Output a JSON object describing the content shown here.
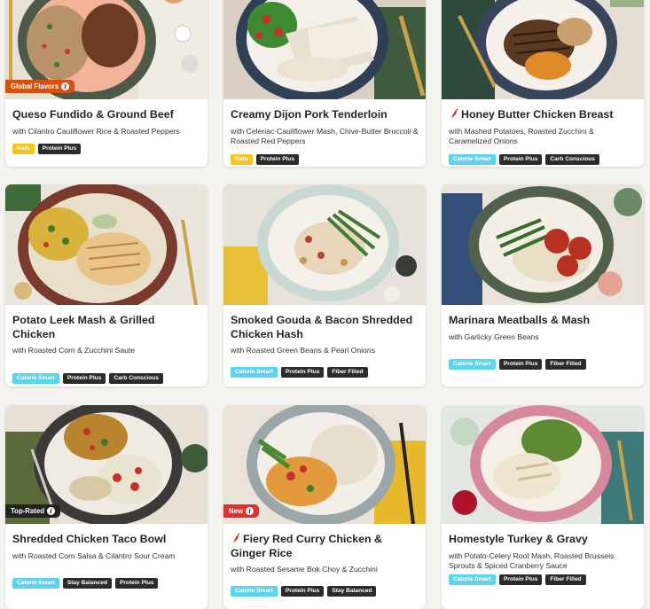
{
  "meals": [
    {
      "title": "Queso Fundido & Ground Beef",
      "subtitle": "with Cilantro Cauliflower Rice & Roasted Peppers",
      "badge": "Global Flavors",
      "spicy": false,
      "tags": [
        "Keto",
        "Protein Plus"
      ],
      "photo": "beef-rice-bowl"
    },
    {
      "title": "Creamy Dijon Pork Tenderloin",
      "subtitle": "with Celeriac-Cauliflower Mash, Chive-Butter Broccoli & Roasted Red Peppers",
      "badge": "",
      "spicy": false,
      "tags": [
        "Keto",
        "Protein Plus"
      ],
      "photo": "pork-plate"
    },
    {
      "title": "Honey Butter Chicken Breast",
      "subtitle": "with Mashed Potatoes, Roasted Zucchini & Caramelized Onions",
      "badge": "",
      "spicy": true,
      "tags": [
        "Calorie Smart",
        "Protein Plus",
        "Carb Conscious"
      ],
      "photo": "chicken-plate"
    },
    {
      "title": "Potato Leek Mash & Grilled Chicken",
      "subtitle": "with Roasted Corn & Zucchini Saute",
      "badge": "",
      "spicy": false,
      "tags": [
        "Calorie Smart",
        "Protein Plus",
        "Carb Conscious"
      ],
      "photo": "grilled-chicken-plate"
    },
    {
      "title": "Smoked Gouda & Bacon Shredded Chicken Hash",
      "subtitle": "with Roasted Green Beans & Pearl Onions",
      "badge": "",
      "spicy": false,
      "tags": [
        "Calorie Smart",
        "Protein Plus",
        "Fiber Filled"
      ],
      "photo": "chicken-hash-plate"
    },
    {
      "title": "Marinara Meatballs & Mash",
      "subtitle": "with Garlicky Green Beans",
      "badge": "",
      "spicy": false,
      "tags": [
        "Calorie Smart",
        "Protein Plus",
        "Fiber Filled"
      ],
      "photo": "meatballs-plate"
    },
    {
      "title": "Shredded Chicken Taco Bowl",
      "subtitle": "with Roasted Corn Salsa & Cilantro Sour Cream",
      "badge": "Top-Rated",
      "spicy": false,
      "tags": [
        "Calorie Smart",
        "Stay Balanced",
        "Protein Plus"
      ],
      "photo": "taco-bowl"
    },
    {
      "title": "Fiery Red Curry Chicken & Ginger Rice",
      "subtitle": "with Roasted Sesame Bok Choy & Zucchini",
      "badge": "New",
      "spicy": true,
      "tags": [
        "Calorie Smart",
        "Protein Plus",
        "Stay Balanced"
      ],
      "photo": "curry-plate"
    },
    {
      "title": "Homestyle Turkey & Gravy",
      "subtitle": "with Potato-Celery Root Mash, Roasted Brussels Sprouts & Spiced Cranberry Sauce",
      "badge": "",
      "spicy": false,
      "tags": [
        "Calorie Smart",
        "Protein Plus",
        "Fiber Filled"
      ],
      "photo": "turkey-plate"
    }
  ],
  "colors": {
    "badge_global": "#d4520f",
    "badge_top": "#222222",
    "badge_new": "#e0312f",
    "tag_dark": "#2b2b2b",
    "tag_cyan": "#58d6f1",
    "tag_yellow": "#f5c518",
    "chili": "#d9261c"
  }
}
